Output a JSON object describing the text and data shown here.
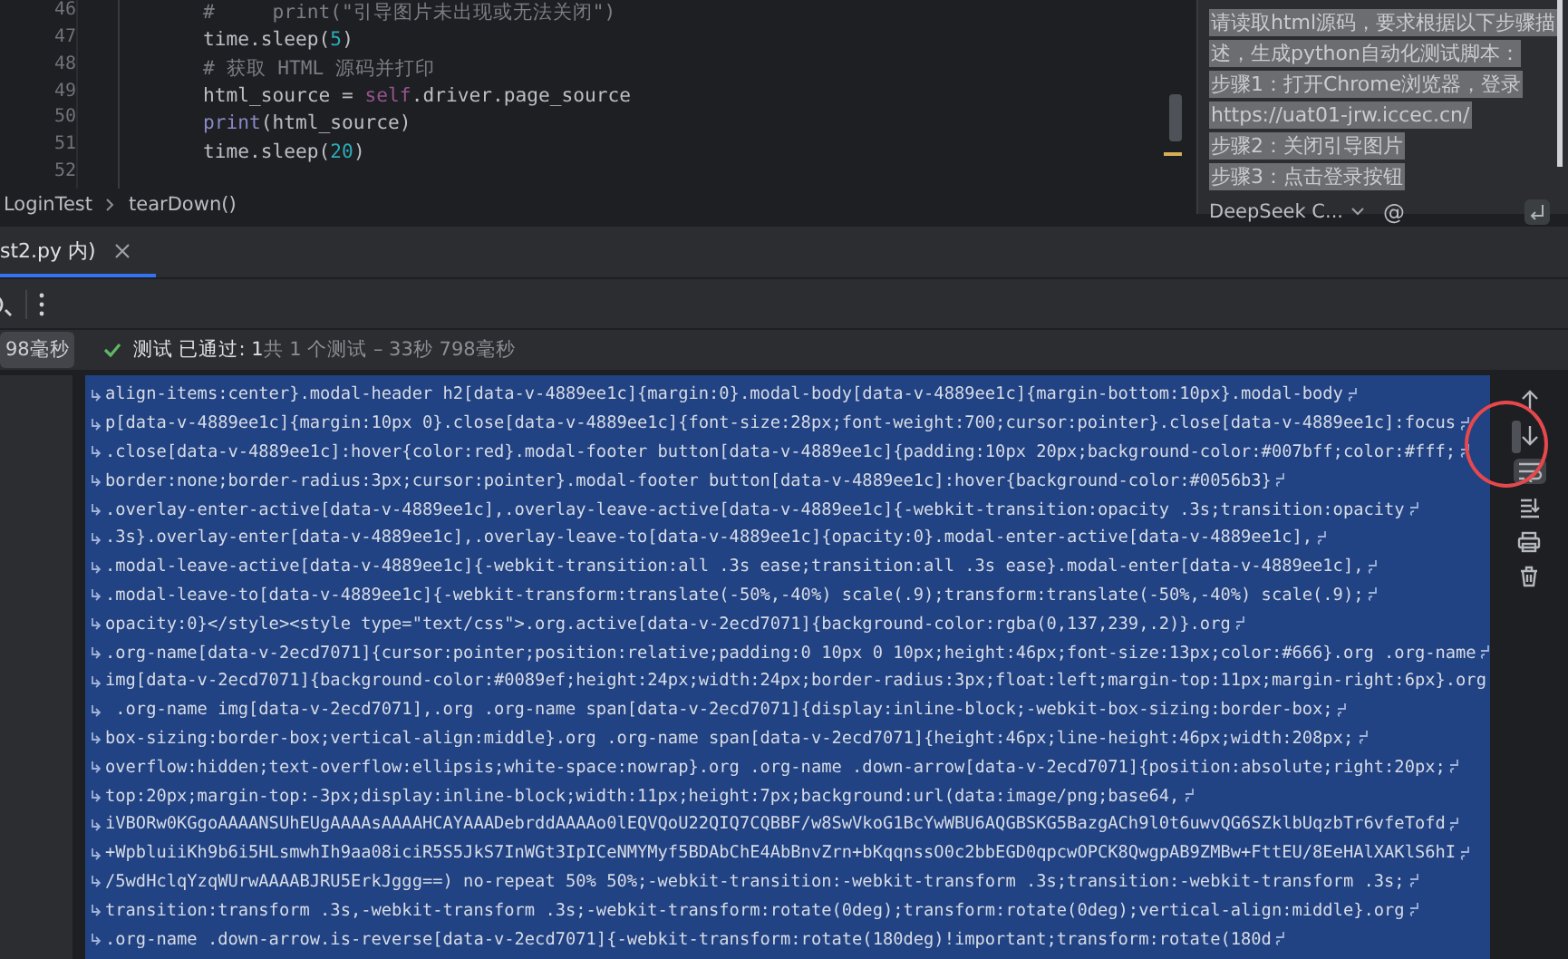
{
  "editor": {
    "lines": [
      {
        "number": "46",
        "segments": [
          {
            "kind": "comment",
            "text": "#     print(\"引导图片未出现或无法关闭\")"
          }
        ]
      },
      {
        "number": "47",
        "segments": [
          {
            "kind": "plain",
            "text": "time.sleep("
          },
          {
            "kind": "number",
            "text": "5"
          },
          {
            "kind": "plain",
            "text": ")"
          }
        ]
      },
      {
        "number": "48",
        "segments": [
          {
            "kind": "comment",
            "text": "# 获取 HTML 源码并打印"
          }
        ]
      },
      {
        "number": "49",
        "segments": [
          {
            "kind": "plain",
            "text": "html_source = "
          },
          {
            "kind": "keyword",
            "text": "self"
          },
          {
            "kind": "plain",
            "text": ".driver.page_source"
          }
        ]
      },
      {
        "number": "50",
        "segments": [
          {
            "kind": "builtin",
            "text": "print"
          },
          {
            "kind": "plain",
            "text": "(html_source)"
          }
        ]
      },
      {
        "number": "51",
        "segments": [
          {
            "kind": "plain",
            "text": "time.sleep("
          },
          {
            "kind": "number",
            "text": "20"
          },
          {
            "kind": "plain",
            "text": ")"
          }
        ]
      },
      {
        "number": "52"
      }
    ]
  },
  "breadcrumb": [
    "LoginTest",
    "tearDown()"
  ],
  "chat": {
    "lines": [
      "请读取html源码，要求根据以下步骤描",
      "述，生成python自动化测试脚本：",
      "步骤1：打开Chrome浏览器，登录",
      "https://uat01-jrw.iccec.cn/",
      "步骤2：关闭引导图片",
      "步骤3：点击登录按钮"
    ],
    "model": "DeepSeek C...",
    "mention": "@"
  },
  "run_tab": {
    "label": "st2.py 内)",
    "selected": true
  },
  "status": {
    "duration": "98毫秒",
    "summary": "**测试 已通过: 1**共 1 个测试 – 33秒 798毫秒"
  },
  "console": {
    "lines": [
      "align-items:center}.modal-header h2[data-v-4889ee1c]{margin:0}.modal-body[data-v-4889ee1c]{margin-bottom:10px}.modal-body",
      "p[data-v-4889ee1c]{margin:10px 0}.close[data-v-4889ee1c]{font-size:28px;font-weight:700;cursor:pointer}.close[data-v-4889ee1c]:focus",
      ".close[data-v-4889ee1c]:hover{color:red}.modal-footer button[data-v-4889ee1c]{padding:10px 20px;background-color:#007bff;color:#fff;",
      "border:none;border-radius:3px;cursor:pointer}.modal-footer button[data-v-4889ee1c]:hover{background-color:#0056b3}",
      ".overlay-enter-active[data-v-4889ee1c],.overlay-leave-active[data-v-4889ee1c]{-webkit-transition:opacity .3s;transition:opacity",
      ".3s}.overlay-enter[data-v-4889ee1c],.overlay-leave-to[data-v-4889ee1c]{opacity:0}.modal-enter-active[data-v-4889ee1c],",
      ".modal-leave-active[data-v-4889ee1c]{-webkit-transition:all .3s ease;transition:all .3s ease}.modal-enter[data-v-4889ee1c],",
      ".modal-leave-to[data-v-4889ee1c]{-webkit-transform:translate(-50%,-40%) scale(.9);transform:translate(-50%,-40%) scale(.9);",
      "opacity:0}</style><style type=\"text/css\">.org.active[data-v-2ecd7071]{background-color:rgba(0,137,239,.2)}.org",
      ".org-name[data-v-2ecd7071]{cursor:pointer;position:relative;padding:0 10px 0 10px;height:46px;font-size:13px;color:#666}.org .org-name",
      "img[data-v-2ecd7071]{background-color:#0089ef;height:24px;width:24px;border-radius:3px;float:left;margin-top:11px;margin-right:6px}.org",
      " .org-name img[data-v-2ecd7071],.org .org-name span[data-v-2ecd7071]{display:inline-block;-webkit-box-sizing:border-box;",
      "box-sizing:border-box;vertical-align:middle}.org .org-name span[data-v-2ecd7071]{height:46px;line-height:46px;width:208px;",
      "overflow:hidden;text-overflow:ellipsis;white-space:nowrap}.org .org-name .down-arrow[data-v-2ecd7071]{position:absolute;right:20px;",
      "top:20px;margin-top:-3px;display:inline-block;width:11px;height:7px;background:url(data:image/png;base64,",
      "iVBORw0KGgoAAAANSUhEUgAAAAsAAAAHCAYAAADebrddAAAAo0lEQVQoU22QIQ7CQBBF/w8SwVkoG1BcYwWBU6AQGBSKG5BazgACh9l0t6uwvQG6SZklbUqzbTr6vfeTofd",
      "+WpbluiiKh9b6i5HLsmwhIh9aa08iciR5S5JkS7InWGt3IpICeNMYMyf5BDAbChE4AbBnvZrn+bKqqnssO0c2bbEGD0qpcwOPCK8QwgpAB9ZMBw+FttEU/8EeHAlXAKlS6hI",
      "/5wdHclqYzqWUrwAAAABJRU5ErkJggg==) no-repeat 50% 50%;-webkit-transition:-webkit-transform .3s;transition:-webkit-transform .3s;",
      "transition:transform .3s,-webkit-transform .3s;-webkit-transform:rotate(0deg);transform:rotate(0deg);vertical-align:middle}.org",
      ".org-name .down-arrow.is-reverse[data-v-2ecd7071]{-webkit-transform:rotate(180deg)!important;transform:rotate(180d"
    ],
    "soft_wrap": true
  }
}
